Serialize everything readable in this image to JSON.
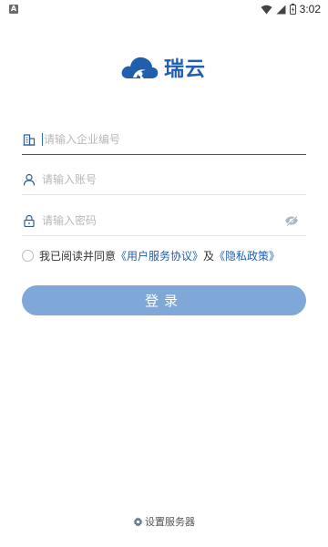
{
  "status_bar": {
    "notification_icon": "a-box-icon",
    "time": "3:02",
    "icons": [
      "wifi-icon",
      "signal-icon",
      "battery-icon"
    ]
  },
  "logo": {
    "text": "瑞云",
    "brand_color": "#1f5fae"
  },
  "form": {
    "company_placeholder": "请输入企业编号",
    "account_placeholder": "请输入账号",
    "password_placeholder": "请输入密码"
  },
  "agreement": {
    "prefix": "我已阅读并同意",
    "user_agreement": "《用户服务协议》",
    "and": "及",
    "privacy_policy": "《隐私政策》",
    "link_color": "#1e5fb0"
  },
  "login_button": {
    "label": "登录",
    "color": "#7fa8d8"
  },
  "server_settings": {
    "label": "设置服务器"
  }
}
